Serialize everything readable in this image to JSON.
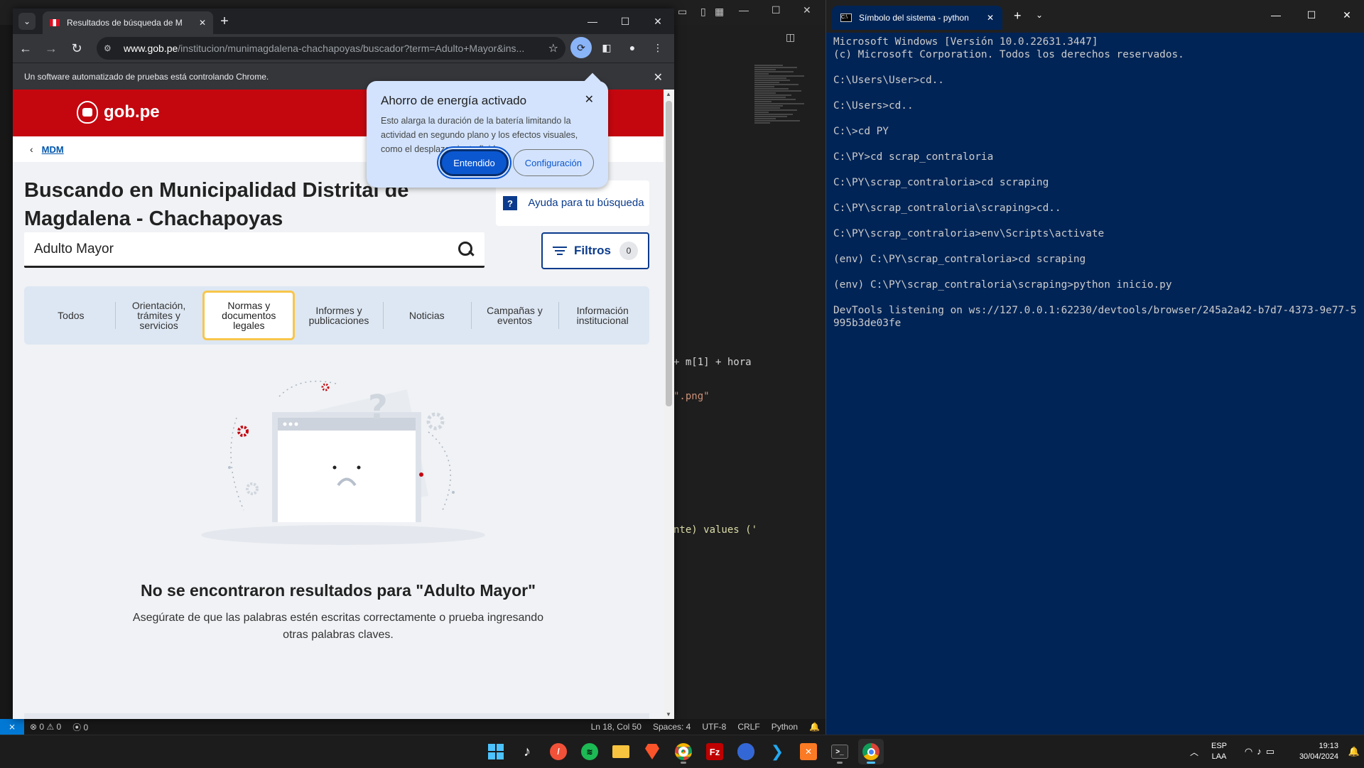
{
  "vscode": {
    "code_lines": [
      "+ m[1] + hora",
      "\".png\"",
      "",
      "",
      "",
      "",
      "",
      "nte) values ('"
    ],
    "status": {
      "errors": "0",
      "warnings": "0",
      "ports": "0",
      "position": "Ln 18, Col 50",
      "spaces": "Spaces: 4",
      "encoding": "UTF-8",
      "eol": "CRLF",
      "language": "Python"
    }
  },
  "chrome": {
    "tab_title": "Resultados de búsqueda de M",
    "url_host": "www.gob.pe",
    "url_path": "/institucion/munimagdalena-chachapoyas/buscador?term=Adulto+Mayor&ins...",
    "infobar_text": "Un software automatizado de pruebas está controlando Chrome.",
    "energy_popup": {
      "title": "Ahorro de energía activado",
      "body": "Esto alarga la duración de la batería limitando la actividad en segundo plano y los efectos visuales, como el desplazamiento fluido",
      "primary": "Entendido",
      "secondary": "Configuración"
    }
  },
  "page": {
    "logo_text": "gob.pe",
    "breadcrumb": "MDM",
    "title": "Buscando en Municipalidad Distrital de Magdalena - Chachapoyas",
    "help_button": "Ayuda para tu búsqueda",
    "search_value": "Adulto Mayor",
    "filter_label": "Filtros",
    "filter_count": "0",
    "tabs": [
      {
        "label": "Todos"
      },
      {
        "label": "Orientación, trámites y servicios"
      },
      {
        "label": "Normas y documentos legales"
      },
      {
        "label": "Informes y publicaciones"
      },
      {
        "label": "Noticias"
      },
      {
        "label": "Campañas y eventos"
      },
      {
        "label": "Información institucional"
      }
    ],
    "active_tab": "Normas y documentos legales",
    "empty_title": "No se encontraron resultados para \"Adulto Mayor\"",
    "empty_desc": "Asegúrate de que las palabras estén escritas correctamente o prueba ingresando otras palabras claves."
  },
  "terminal": {
    "tab_title": "Símbolo del sistema - python",
    "lines": [
      "Microsoft Windows [Versión 10.0.22631.3447]",
      "(c) Microsoft Corporation. Todos los derechos reservados.",
      "",
      "C:\\Users\\User>cd..",
      "",
      "C:\\Users>cd..",
      "",
      "C:\\>cd PY",
      "",
      "C:\\PY>cd scrap_contraloria",
      "",
      "C:\\PY\\scrap_contraloria>cd scraping",
      "",
      "C:\\PY\\scrap_contraloria\\scraping>cd..",
      "",
      "C:\\PY\\scrap_contraloria>env\\Scripts\\activate",
      "",
      "(env) C:\\PY\\scrap_contraloria>cd scraping",
      "",
      "(env) C:\\PY\\scrap_contraloria\\scraping>python inicio.py",
      "",
      "DevTools listening on ws://127.0.0.1:62230/devtools/browser/245a2a42-b7d7-4373-9e77-5995b3de03fe"
    ]
  },
  "taskbar": {
    "apps": [
      "start-icon",
      "tiktok-icon",
      "swift-icon",
      "spotify-icon",
      "file-explorer-icon",
      "brave-icon",
      "chrome-dev-icon",
      "filezilla-icon",
      "chrome-canary-icon",
      "vscode-icon",
      "xampp-icon",
      "terminal-icon",
      "chrome-icon"
    ],
    "lang_top": "ESP",
    "lang_bottom": "LAA",
    "time": "19:13",
    "date": "30/04/2024"
  }
}
